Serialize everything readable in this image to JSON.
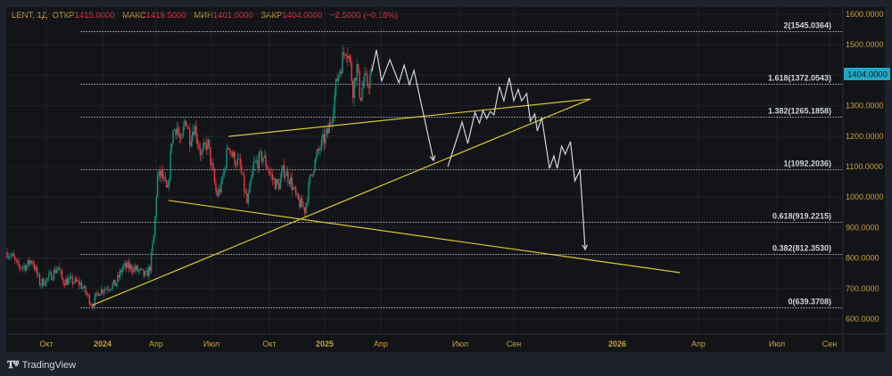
{
  "header": {
    "symbol": "LENT, 1Д",
    "open_label": "ОТКР",
    "open": "1415.0000",
    "high_label": "МАКС",
    "high": "1419.5000",
    "low_label": "МИН",
    "low": "1401.0000",
    "close_label": "ЗАКР",
    "close": "1404.0000",
    "change": "−2.5000 (−0.18%)"
  },
  "footer": {
    "brand": "TradingView"
  },
  "colors": {
    "up": "#089981",
    "down": "#f23645",
    "trendline": "#d8c630",
    "projection": "#d1d4dc",
    "price_badge": "#22a8c4",
    "axis_text": "#c9a03c"
  },
  "chart_data": {
    "type": "candlestick",
    "symbol": "LENT",
    "interval": "1Д",
    "time_unit": "months since Oct 2023",
    "ylim": [
      560,
      1640
    ],
    "y_ticks": [
      "1600.0000",
      "1500.0000",
      "1300.0000",
      "1200.0000",
      "1100.0000",
      "1000.0000",
      "900.0000",
      "800.0000",
      "700.0000",
      "600.0000"
    ],
    "y_tick_values": [
      1600,
      1500,
      1300,
      1200,
      1100,
      1000,
      900,
      800,
      700,
      600
    ],
    "x_ticks": [
      {
        "t": 0,
        "label": "Окт"
      },
      {
        "t": 3,
        "label": "2024"
      },
      {
        "t": 6,
        "label": "Апр"
      },
      {
        "t": 9,
        "label": "Июл"
      },
      {
        "t": 12,
        "label": "Окт"
      },
      {
        "t": 15,
        "label": "2025"
      },
      {
        "t": 18,
        "label": "Апр"
      },
      {
        "t": 21,
        "label": "Июл"
      },
      {
        "t": 23,
        "label": "Сен"
      },
      {
        "t": 27,
        "label": "2026"
      },
      {
        "t": 30,
        "label": "Апр"
      },
      {
        "t": 33,
        "label": "Июл"
      },
      {
        "t": 35,
        "label": "Сен"
      }
    ],
    "last_price": "1404.0000",
    "last_price_value": 1404,
    "price_path": [
      [
        -2.11,
        820
      ],
      [
        -1.78,
        800
      ],
      [
        -1.54,
        770
      ],
      [
        -1.06,
        775
      ],
      [
        -0.77,
        795
      ],
      [
        -0.34,
        715
      ],
      [
        0.14,
        735
      ],
      [
        0.62,
        770
      ],
      [
        0.86,
        725
      ],
      [
        1.34,
        725
      ],
      [
        1.82,
        715
      ],
      [
        2.16,
        680
      ],
      [
        2.45,
        645
      ],
      [
        2.78,
        690
      ],
      [
        3.26,
        705
      ],
      [
        3.74,
        715
      ],
      [
        4.13,
        770
      ],
      [
        4.61,
        770
      ],
      [
        5.09,
        755
      ],
      [
        5.42,
        740
      ],
      [
        5.66,
        770
      ],
      [
        5.9,
        885
      ],
      [
        6.05,
        1060
      ],
      [
        6.29,
        1075
      ],
      [
        6.63,
        1010
      ],
      [
        6.87,
        1210
      ],
      [
        7.11,
        1235
      ],
      [
        7.35,
        1165
      ],
      [
        7.59,
        1265
      ],
      [
        7.83,
        1195
      ],
      [
        8.07,
        1237
      ],
      [
        8.45,
        1135
      ],
      [
        8.79,
        1180
      ],
      [
        9.27,
        1005
      ],
      [
        9.51,
        1035
      ],
      [
        9.89,
        1180
      ],
      [
        10.08,
        1135
      ],
      [
        10.47,
        1105
      ],
      [
        10.85,
        975
      ],
      [
        11.19,
        1105
      ],
      [
        11.67,
        1135
      ],
      [
        12.15,
        1060
      ],
      [
        12.48,
        1035
      ],
      [
        12.77,
        1090
      ],
      [
        13.11,
        1060
      ],
      [
        13.49,
        990
      ],
      [
        13.92,
        960
      ],
      [
        14.31,
        1090
      ],
      [
        14.59,
        1135
      ],
      [
        14.88,
        1180
      ],
      [
        15.17,
        1210
      ],
      [
        15.41,
        1280
      ],
      [
        15.65,
        1385
      ],
      [
        15.89,
        1440
      ],
      [
        16.13,
        1500
      ],
      [
        16.32,
        1455
      ],
      [
        16.51,
        1355
      ],
      [
        16.71,
        1430
      ],
      [
        16.9,
        1325
      ],
      [
        17.09,
        1385
      ],
      [
        17.28,
        1370
      ],
      [
        17.52,
        1404
      ]
    ],
    "fibonacci": [
      {
        "label": "2(1545.0364)",
        "value": 1545.0364
      },
      {
        "label": "1.618(1372.0543)",
        "value": 1372.0543
      },
      {
        "label": "1.382(1265.1858)",
        "value": 1265.1858
      },
      {
        "label": "1(1092.2036)",
        "value": 1092.2036
      },
      {
        "label": "0.618(919.2215)",
        "value": 919.2215
      },
      {
        "label": "0.382(812.3530)",
        "value": 812.353
      },
      {
        "label": "0(639.3708)",
        "value": 639.3708
      }
    ],
    "fib_start_t": 1.83,
    "trendlines": [
      [
        [
          2.45,
          645
        ],
        [
          25.97,
          1322
        ]
      ],
      [
        [
          9.89,
          1199
        ],
        [
          25.97,
          1322
        ]
      ],
      [
        [
          6.67,
          989
        ],
        [
          29.32,
          752
        ]
      ]
    ],
    "projections": [
      [
        [
          17.52,
          1413
        ],
        [
          17.76,
          1483
        ],
        [
          18.03,
          1381
        ],
        [
          18.34,
          1451
        ],
        [
          18.68,
          1375
        ],
        [
          18.88,
          1433
        ],
        [
          19.08,
          1369
        ],
        [
          19.25,
          1416
        ],
        [
          19.99,
          1120
        ]
      ],
      [
        [
          20.53,
          1100
        ],
        [
          21.07,
          1246
        ],
        [
          21.28,
          1176
        ],
        [
          21.55,
          1278
        ],
        [
          21.72,
          1243
        ],
        [
          21.85,
          1284
        ],
        [
          21.99,
          1258
        ],
        [
          22.12,
          1281
        ],
        [
          22.26,
          1270
        ],
        [
          22.46,
          1363
        ],
        [
          22.63,
          1316
        ],
        [
          22.83,
          1392
        ],
        [
          23.0,
          1316
        ],
        [
          23.17,
          1354
        ],
        [
          23.3,
          1316
        ],
        [
          23.5,
          1340
        ],
        [
          23.64,
          1249
        ],
        [
          23.81,
          1273
        ],
        [
          23.91,
          1217
        ],
        [
          24.08,
          1261
        ],
        [
          24.38,
          1094
        ],
        [
          24.55,
          1135
        ],
        [
          24.68,
          1094
        ],
        [
          24.85,
          1167
        ],
        [
          24.99,
          1141
        ],
        [
          25.19,
          1182
        ],
        [
          25.36,
          1053
        ],
        [
          25.56,
          1088
        ],
        [
          25.76,
          828
        ]
      ]
    ]
  }
}
